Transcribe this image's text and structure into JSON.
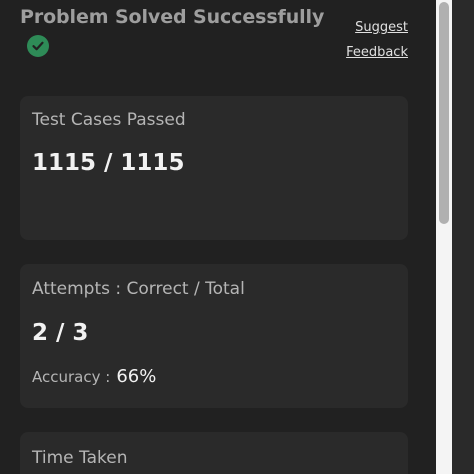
{
  "header": {
    "title": "Problem Solved Successfully",
    "status_icon": "check-circle-icon",
    "suggest_label": "Suggest",
    "feedback_label": "Feedback"
  },
  "cards": {
    "tests": {
      "title": "Test Cases Passed",
      "value": "1115 / 1115"
    },
    "attempts": {
      "title": "Attempts : Correct / Total",
      "value": "2 / 3",
      "accuracy_label": "Accuracy :",
      "accuracy_value": "66%"
    },
    "time": {
      "title": "Time Taken"
    }
  },
  "colors": {
    "background": "#212121",
    "card": "#2a2a2a",
    "success": "#2e8b57"
  }
}
